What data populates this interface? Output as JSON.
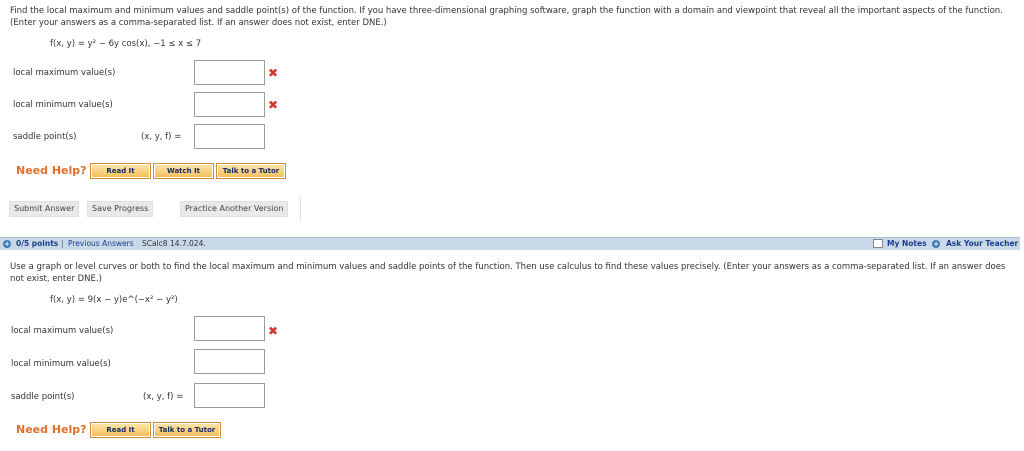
{
  "q1": {
    "prompt": "Find the local maximum and minimum values and saddle point(s) of the function. If you have three-dimensional graphing software, graph the function with a domain and viewpoint that reveal all the important aspects of the function. (Enter your answers as a comma-separated list. If an answer does not exist, enter DNE.)",
    "function": "f(x, y) = y² − 6y cos(x),    −1 ≤ x ≤ 7",
    "label_max": "local maximum value(s)",
    "label_min": "local minimum value(s)",
    "label_saddle": "saddle point(s)",
    "saddle_prefix": "(x, y, f) =",
    "max_value": "",
    "min_value": "",
    "saddle_value": "",
    "max_mark": "✖",
    "min_mark": "✖",
    "need_help": "Need Help?",
    "read_it": "Read It",
    "watch_it": "Watch It",
    "talk_tutor": "Talk to a Tutor"
  },
  "actions": {
    "submit": "Submit Answer",
    "save": "Save Progress",
    "practice": "Practice Another Version"
  },
  "q2_bar": {
    "points": "0/5 points",
    "previous": "Previous Answers",
    "ref": "SCalc8 14.7.024.",
    "my_notes": "My Notes",
    "ask_teacher": "Ask Your Teacher"
  },
  "q2": {
    "prompt": "Use a graph or level curves or both to find the local maximum and minimum values and saddle points of the function. Then use calculus to find these values precisely. (Enter your answers as a comma-separated list. If an answer does not exist, enter DNE.)",
    "function": "f(x, y) = 9(x − y)e^(−x² − y²)",
    "label_max": "local maximum value(s)",
    "label_min": "local minimum value(s)",
    "label_saddle": "saddle point(s)",
    "saddle_prefix": "(x, y, f) =",
    "max_value": "",
    "min_value": "",
    "saddle_value": "",
    "max_mark": "✖",
    "need_help": "Need Help?",
    "read_it": "Read It",
    "talk_tutor": "Talk to a Tutor"
  },
  "colors": {
    "accent": "#e0702a",
    "error": "#d9342b",
    "bar": "#c9d9ea",
    "link": "#1a3d8a"
  }
}
